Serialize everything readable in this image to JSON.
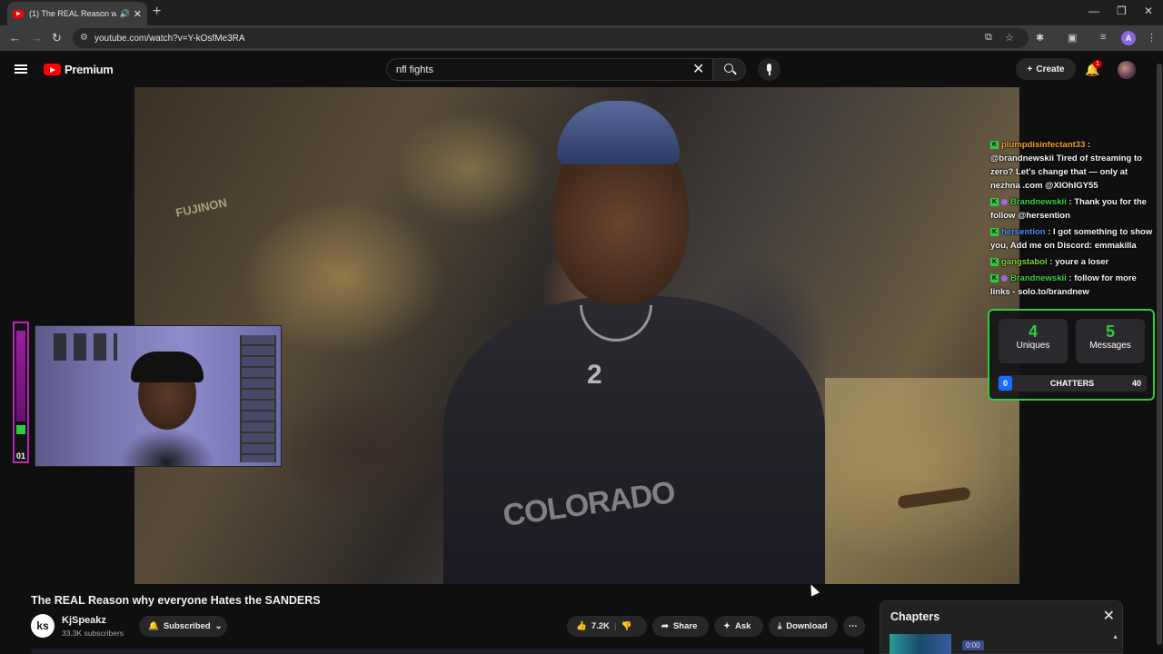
{
  "browser": {
    "tab_title": "(1) The REAL Reason why e...",
    "new_tab": "+",
    "url": "youtube.com/watch?v=Y-kOsfMe3RA",
    "profile_initial": "A"
  },
  "youtube": {
    "logo_text": "Premium",
    "search_value": "nfl fights",
    "create_label": "Create",
    "notification_count": "1"
  },
  "webcam_meter": {
    "count": "01"
  },
  "video_overlay": {
    "cam_text": "FUJINON",
    "jersey_text": "COLORADO",
    "jersey_number": "2"
  },
  "chat": [
    {
      "user": "plumpdisinfectant33",
      "text": " : @brandnewskii Tired of streaming to zero? Let's change that — only at nezhna .com @XIOhIGY55",
      "color": "u-orange",
      "mod": false
    },
    {
      "user": "Brandnewskii",
      "text": " : Thank you for the follow @hersention",
      "color": "u-green",
      "mod": true
    },
    {
      "user": "hersention",
      "text": " : I got something to show you, Add me on Discord: emmakilla",
      "color": "u-blue",
      "mod": false
    },
    {
      "user": "gangstaboi",
      "text": " : youre a loser",
      "color": "u-lime",
      "mod": false
    },
    {
      "user": "Brandnewskii",
      "text": " : follow for more links - solo.to/brandnew",
      "color": "u-green",
      "mod": true
    }
  ],
  "stats": {
    "uniques_value": "4",
    "uniques_label": "Uniques",
    "messages_value": "5",
    "messages_label": "Messages",
    "chatters_left": "0",
    "chatters_label": "CHATTERS",
    "chatters_right": "40"
  },
  "video": {
    "title": "The REAL Reason why everyone Hates the SANDERS",
    "channel_name": "KjSpeakz",
    "channel_subs": "33.3K subscribers",
    "subscribed_label": "Subscribed",
    "like_count": "7.2K",
    "share_label": "Share",
    "ask_label": "Ask",
    "download_label": "Download"
  },
  "chapters": {
    "heading": "Chapters",
    "first_time": "0:00"
  }
}
